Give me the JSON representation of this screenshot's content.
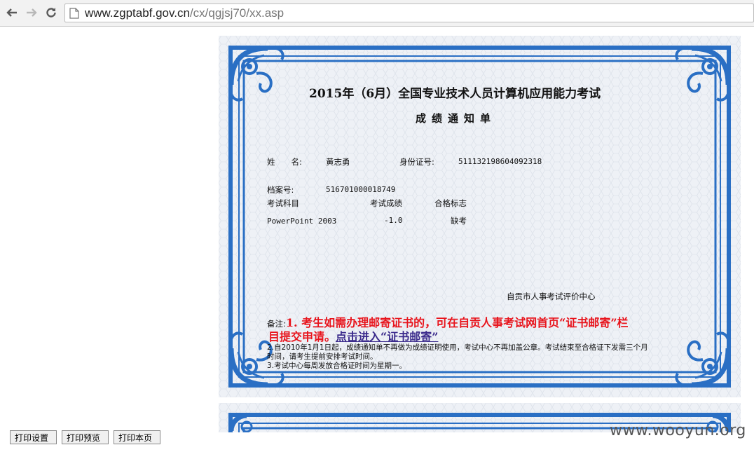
{
  "browser": {
    "url_host": "www.zgptabf.gov.cn",
    "url_path": "/cx/qgjsj70/xx.asp",
    "back_icon": "arrow-left-icon",
    "forward_icon": "arrow-right-icon",
    "reload_icon": "reload-icon"
  },
  "certificate": {
    "title": "2015年（6月）全国专业技术人员计算机应用能力考试",
    "subtitle": "成绩通知单",
    "name_label": "姓　　名:",
    "name_value": "黄志勇",
    "id_label": "身份证号:",
    "id_value": "511132198604092318",
    "file_no_label": "档案号:",
    "file_no_value": "516701000018749",
    "table": {
      "headers": [
        "考试科目",
        "考试成绩",
        "合格标志"
      ],
      "rows": [
        {
          "subject": "PowerPoint 2003",
          "score": "-1.0",
          "status": "缺考"
        }
      ]
    },
    "issuer": "自贡市人事考试评价中心",
    "note_label": "备注:",
    "note1_line1": "1. 考生如需办理邮寄证书的，可在自贡人事考试网首页“证书邮寄”栏",
    "note1_line2_text": "目提交申请。",
    "note1_link": "点击进入“证书邮寄”",
    "note2_line1": "2.自2010年1月1日起，成绩通知单不再做为成绩证明使用，考试中心不再加盖公章。考试结束至合格证下发需三个月",
    "note2_line2": "时间，请考生提前安排考试时间。",
    "note3": "3.考试中心每周发放合格证时间为星期一。",
    "border_color": "#2a6fc4"
  },
  "print_buttons": {
    "setup": "打印设置",
    "preview": "打印预览",
    "print": "打印本页"
  },
  "watermark": "www.wooyun.org"
}
